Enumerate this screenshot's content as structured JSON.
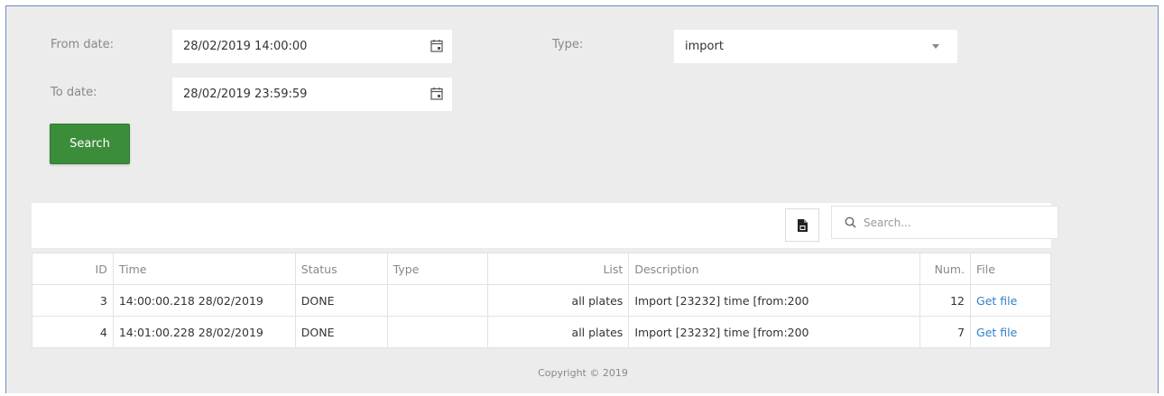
{
  "filters": {
    "from_label": "From date:",
    "from_value": "28/02/2019 14:00:00",
    "to_label": "To date:",
    "to_value": "28/02/2019 23:59:59",
    "type_label": "Type:",
    "type_value": "import",
    "search_button": "Search"
  },
  "table_search": {
    "placeholder": "Search..."
  },
  "table": {
    "headers": [
      "ID",
      "Time",
      "Status",
      "Type",
      "List",
      "Description",
      "Num.",
      "File"
    ],
    "rows": [
      {
        "id": "3",
        "time": "14:00:00.218 28/02/2019",
        "status": "DONE",
        "type": "",
        "list": "all plates",
        "description": "Import [23232] time [from:200",
        "num": "12",
        "file": "Get file"
      },
      {
        "id": "4",
        "time": "14:01:00.228 28/02/2019",
        "status": "DONE",
        "type": "",
        "list": "all plates",
        "description": "Import [23232] time [from:200",
        "num": "7",
        "file": "Get file"
      }
    ]
  },
  "footer": {
    "copyright": "Copyright © 2019"
  },
  "colors": {
    "accent": "#3c8d3a",
    "link": "#2f80c8",
    "background": "#ececec",
    "frame_border": "#6a8fc4"
  },
  "icons": {
    "date_picker": "calendar-icon",
    "type_select": "chevron-down-icon",
    "export": "file-export-icon",
    "search": "search-icon"
  }
}
